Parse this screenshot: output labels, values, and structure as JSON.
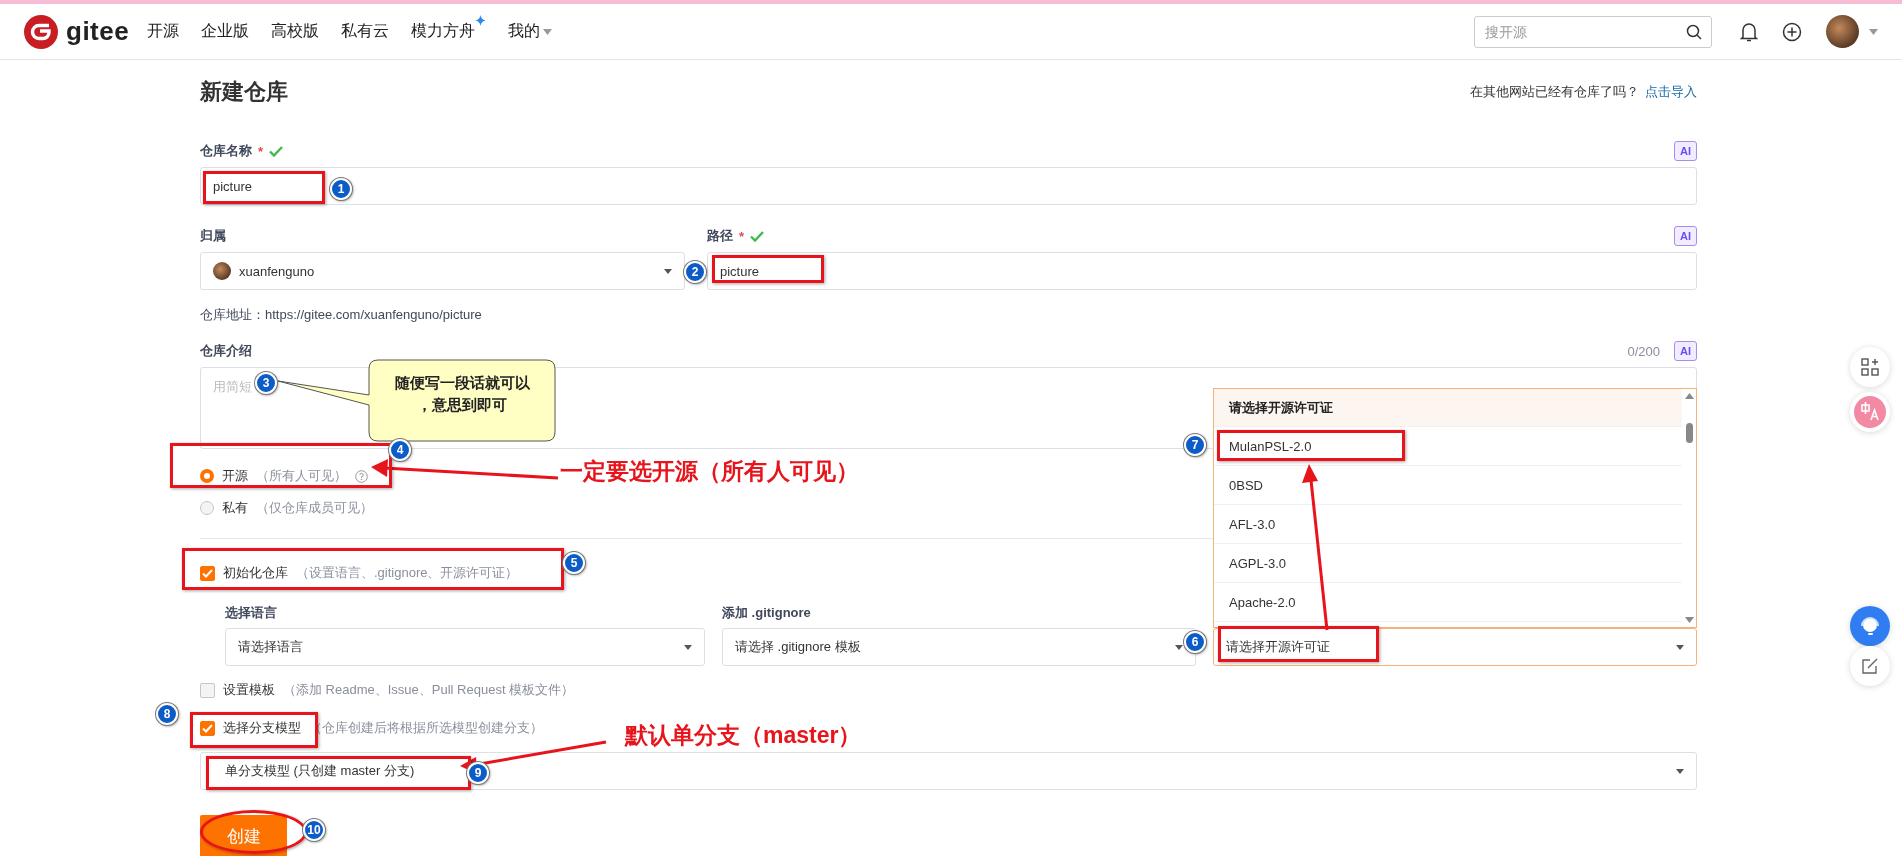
{
  "nav": {
    "logo": "gitee",
    "items": [
      {
        "label": "开源",
        "kind": "link"
      },
      {
        "label": "企业版",
        "kind": "link"
      },
      {
        "label": "高校版",
        "kind": "link"
      },
      {
        "label": "私有云",
        "kind": "link"
      },
      {
        "label": "模力方舟",
        "kind": "featured"
      },
      {
        "label": "我的",
        "kind": "menu"
      }
    ],
    "search": {
      "placeholder": "搜开源"
    }
  },
  "page": {
    "title": "新建仓库",
    "import_question": "在其他网站已经有仓库了吗？",
    "import_link": "点击导入"
  },
  "name_field": {
    "label": "仓库名称",
    "required_mark": "*",
    "ai": "AI",
    "value": "picture"
  },
  "owner_field": {
    "label": "归属",
    "value": "xuanfenguno"
  },
  "path_field": {
    "label": "路径",
    "required_mark": "*",
    "ai": "AI",
    "value": "picture"
  },
  "address": "仓库地址：https://gitee.com/xuanfenguno/picture",
  "intro_field": {
    "label": "仓库介绍",
    "counter": "0/200",
    "ai": "AI",
    "placeholder": "用简短"
  },
  "visibility": [
    {
      "label": "开源",
      "hint": "（所有人可见）",
      "selected": true
    },
    {
      "label": "私有",
      "hint": "（仅仓库成员可见）",
      "selected": false
    }
  ],
  "init": {
    "label": "初始化仓库",
    "hint": "（设置语言、.gitignore、开源许可证）",
    "checked": true
  },
  "language": {
    "label": "选择语言",
    "value": "请选择语言"
  },
  "gitignore": {
    "label": "添加 .gitignore",
    "value": "请选择 .gitignore 模板"
  },
  "license": {
    "value": "请选择开源许可证",
    "expanded": true,
    "options": [
      {
        "label": "请选择开源许可证",
        "kind": "header"
      },
      {
        "label": "MulanPSL-2.0",
        "kind": "option"
      },
      {
        "label": "0BSD",
        "kind": "option"
      },
      {
        "label": "AFL-3.0",
        "kind": "option"
      },
      {
        "label": "AGPL-3.0",
        "kind": "option"
      },
      {
        "label": "Apache-2.0",
        "kind": "option"
      }
    ]
  },
  "template": {
    "label": "设置模板",
    "hint": "（添加 Readme、Issue、Pull Request 模板文件）",
    "checked": false
  },
  "branch": {
    "label": "选择分支模型",
    "hint": "（仓库创建后将根据所选模型创建分支）",
    "checked": true,
    "value": "单分支模型 (只创建 master 分支)"
  },
  "create_button": "创建",
  "annotations": {
    "markers": [
      "1",
      "2",
      "3",
      "4",
      "5",
      "6",
      "7",
      "8",
      "9",
      "10"
    ],
    "callout": [
      "随便写一段话就可以",
      "，意思到即可"
    ],
    "notes": [
      "一定要选开源（所有人可见）",
      "默认单分支（master）"
    ]
  }
}
